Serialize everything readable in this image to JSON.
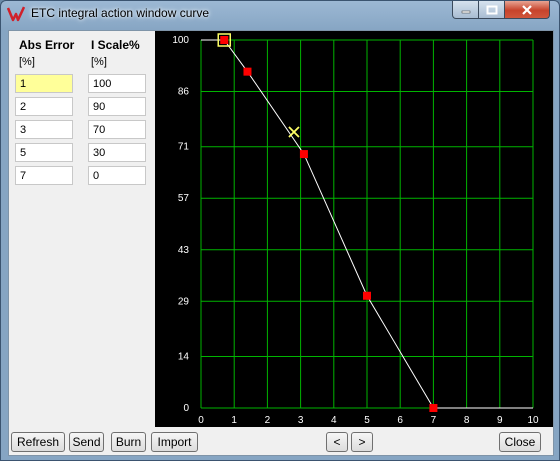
{
  "window": {
    "title": "ETC integral action window curve",
    "controls": {
      "minimize_icon": "minimize-icon",
      "maximize_icon": "maximize-icon",
      "close_icon": "close-icon"
    }
  },
  "table": {
    "headers": [
      "Abs Error",
      "I Scale%"
    ],
    "units": [
      "[%]",
      "[%]"
    ],
    "rows": [
      [
        "1",
        "100"
      ],
      [
        "2",
        "90"
      ],
      [
        "3",
        "70"
      ],
      [
        "5",
        "30"
      ],
      [
        "7",
        "0"
      ]
    ],
    "selected_cell": "1"
  },
  "chart_data": {
    "type": "line",
    "x": [
      0.7,
      1.4,
      3.1,
      5.0,
      7.0
    ],
    "y": [
      100,
      91.4,
      69,
      30.5,
      0
    ],
    "x_ticks": [
      "0",
      "1",
      "2",
      "3",
      "4",
      "5",
      "6",
      "7",
      "8",
      "9",
      "10"
    ],
    "y_ticks": [
      "0",
      "14",
      "29",
      "43",
      "57",
      "71",
      "86",
      "100"
    ],
    "xlim": [
      0,
      10
    ],
    "ylim": [
      0,
      100
    ],
    "cursor": {
      "x": 2.8,
      "y": 75
    },
    "selected_index": 0,
    "grid": true,
    "colors": {
      "background": "#000000",
      "grid": "#00b400",
      "line": "#ffffff",
      "point": "#ff0000",
      "highlight": "#ffff66"
    }
  },
  "buttons": {
    "refresh": "Refresh",
    "send": "Send",
    "burn": "Burn",
    "import": "Import",
    "prev": "<",
    "next": ">",
    "close": "Close"
  }
}
